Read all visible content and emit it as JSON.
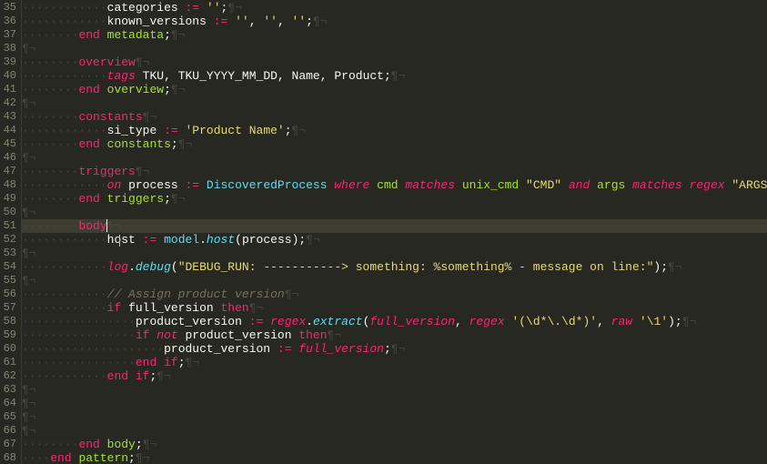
{
  "gutter": {
    "start": 35,
    "end": 68
  },
  "colors": {
    "bg": "#272822",
    "line_hl": "#3e3d32",
    "gutter_fg": "#838570",
    "keyword": "#f92672",
    "type": "#66d9ef",
    "name": "#a6e22e",
    "string": "#e6db74",
    "number": "#ae81ff",
    "comment": "#75715e",
    "fg": "#f8f8f2",
    "whitespace": "#454640"
  },
  "cursor": {
    "line": 51,
    "after_text": "body"
  },
  "lines": {
    "35": [
      3,
      [
        "plain",
        "categories "
      ],
      [
        "op",
        ":="
      ],
      [
        "plain",
        " "
      ],
      [
        "str",
        "''"
      ],
      [
        "punct",
        ";"
      ]
    ],
    "36": [
      3,
      [
        "plain",
        "known_versions "
      ],
      [
        "op",
        ":="
      ],
      [
        "plain",
        " "
      ],
      [
        "str",
        "''"
      ],
      [
        "punct",
        ", "
      ],
      [
        "str",
        "''"
      ],
      [
        "punct",
        ", "
      ],
      [
        "str",
        "''"
      ],
      [
        "punct",
        ";"
      ]
    ],
    "37": [
      2,
      [
        "kw",
        "end"
      ],
      [
        "plain",
        " "
      ],
      [
        "name",
        "metadata"
      ],
      [
        "punct",
        ";"
      ]
    ],
    "38": [
      0
    ],
    "39": [
      2,
      [
        "kw",
        "overview"
      ]
    ],
    "40": [
      3,
      [
        "kw-i",
        "tags"
      ],
      [
        "plain",
        " TKU"
      ],
      [
        "punct",
        ", "
      ],
      [
        "plain",
        "TKU_YYYY_MM_DD"
      ],
      [
        "punct",
        ", "
      ],
      [
        "plain",
        "Name"
      ],
      [
        "punct",
        ", "
      ],
      [
        "plain",
        "Product"
      ],
      [
        "punct",
        ";"
      ]
    ],
    "41": [
      2,
      [
        "kw",
        "end"
      ],
      [
        "plain",
        " "
      ],
      [
        "name",
        "overview"
      ],
      [
        "punct",
        ";"
      ]
    ],
    "42": [
      0
    ],
    "43": [
      2,
      [
        "kw",
        "constants"
      ]
    ],
    "44": [
      3,
      [
        "plain",
        "si_type "
      ],
      [
        "op",
        ":="
      ],
      [
        "plain",
        " "
      ],
      [
        "str",
        "'Product Name'"
      ],
      [
        "punct",
        ";"
      ]
    ],
    "45": [
      2,
      [
        "kw",
        "end"
      ],
      [
        "plain",
        " "
      ],
      [
        "name",
        "constants"
      ],
      [
        "punct",
        ";"
      ]
    ],
    "46": [
      0
    ],
    "47": [
      2,
      [
        "kw",
        "triggers"
      ]
    ],
    "48": [
      3,
      [
        "kw-i",
        "on"
      ],
      [
        "plain",
        " process "
      ],
      [
        "op",
        ":="
      ],
      [
        "plain",
        " "
      ],
      [
        "id",
        "DiscoveredProcess"
      ],
      [
        "plain",
        " "
      ],
      [
        "kw-i",
        "where"
      ],
      [
        "plain",
        " "
      ],
      [
        "name",
        "cmd"
      ],
      [
        "plain",
        " "
      ],
      [
        "kw-i",
        "matches"
      ],
      [
        "plain",
        " "
      ],
      [
        "name",
        "unix_cmd"
      ],
      [
        "plain",
        " "
      ],
      [
        "str",
        "\"CMD\""
      ],
      [
        "plain",
        " "
      ],
      [
        "kw-i",
        "and"
      ],
      [
        "plain",
        " "
      ],
      [
        "name",
        "args"
      ],
      [
        "plain",
        " "
      ],
      [
        "kw-i",
        "matches"
      ],
      [
        "plain",
        " "
      ],
      [
        "kw-i",
        "regex"
      ],
      [
        "plain",
        " "
      ],
      [
        "str",
        "\"ARGS\""
      ],
      [
        "punct",
        ";"
      ]
    ],
    "49": [
      2,
      [
        "kw",
        "end"
      ],
      [
        "plain",
        " "
      ],
      [
        "name",
        "triggers"
      ],
      [
        "punct",
        ";"
      ]
    ],
    "50": [
      0
    ],
    "51": [
      2,
      [
        "kw",
        "body"
      ]
    ],
    "52": [
      3,
      [
        "plain",
        "host "
      ],
      [
        "op",
        ":="
      ],
      [
        "plain",
        " "
      ],
      [
        "id",
        "model"
      ],
      [
        "punct",
        "."
      ],
      [
        "fn",
        "host"
      ],
      [
        "punct",
        "("
      ],
      [
        "plain",
        "process"
      ],
      [
        "punct",
        ");"
      ]
    ],
    "53": [
      0
    ],
    "54": [
      3,
      [
        "kw-i",
        "log"
      ],
      [
        "punct",
        "."
      ],
      [
        "fn",
        "debug"
      ],
      [
        "punct",
        "("
      ],
      [
        "str",
        "\"DEBUG_RUN: -----------> something: %something% - message on line:\""
      ],
      [
        "punct",
        ");"
      ]
    ],
    "55": [
      0
    ],
    "56": [
      3,
      [
        "cmt",
        "// Assign product version"
      ]
    ],
    "57": [
      3,
      [
        "kw",
        "if"
      ],
      [
        "plain",
        " full_version "
      ],
      [
        "kw",
        "then"
      ]
    ],
    "58": [
      4,
      [
        "plain",
        "product_version "
      ],
      [
        "op",
        ":="
      ],
      [
        "plain",
        " "
      ],
      [
        "kw-i",
        "regex"
      ],
      [
        "punct",
        "."
      ],
      [
        "fn",
        "extract"
      ],
      [
        "punct",
        "("
      ],
      [
        "kw-i",
        "full_version"
      ],
      [
        "punct",
        ", "
      ],
      [
        "kw-i",
        "regex"
      ],
      [
        "plain",
        " "
      ],
      [
        "str",
        "'(\\d*\\.\\d*)'"
      ],
      [
        "punct",
        ", "
      ],
      [
        "kw-i",
        "raw"
      ],
      [
        "plain",
        " "
      ],
      [
        "str",
        "'\\1'"
      ],
      [
        "punct",
        ");"
      ]
    ],
    "59": [
      4,
      [
        "kw",
        "if"
      ],
      [
        "plain",
        " "
      ],
      [
        "kw-i",
        "not"
      ],
      [
        "plain",
        " product_version "
      ],
      [
        "kw",
        "then"
      ]
    ],
    "60": [
      5,
      [
        "plain",
        "product_version "
      ],
      [
        "op",
        ":="
      ],
      [
        "plain",
        " "
      ],
      [
        "kw-i",
        "full_version"
      ],
      [
        "punct",
        ";"
      ]
    ],
    "61": [
      4,
      [
        "kw",
        "end"
      ],
      [
        "plain",
        " "
      ],
      [
        "kw",
        "if"
      ],
      [
        "punct",
        ";"
      ]
    ],
    "62": [
      3,
      [
        "kw",
        "end"
      ],
      [
        "plain",
        " "
      ],
      [
        "kw",
        "if"
      ],
      [
        "punct",
        ";"
      ]
    ],
    "63": [
      0
    ],
    "64": [
      0
    ],
    "65": [
      0
    ],
    "66": [
      0
    ],
    "67": [
      2,
      [
        "kw",
        "end"
      ],
      [
        "plain",
        " "
      ],
      [
        "name",
        "body"
      ],
      [
        "punct",
        ";"
      ]
    ],
    "68": [
      1,
      [
        "kw",
        "end"
      ],
      [
        "plain",
        " "
      ],
      [
        "name",
        "pattern"
      ],
      [
        "punct",
        ";"
      ]
    ]
  }
}
